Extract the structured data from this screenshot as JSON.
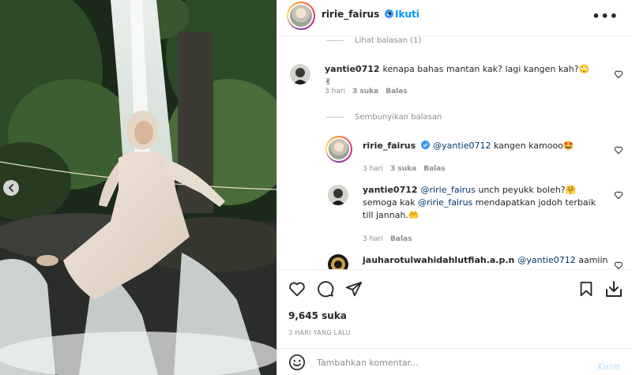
{
  "header": {
    "username": "ririe_fairus",
    "separator": "•",
    "follow_label": "Ikuti",
    "more_label": "•••"
  },
  "comments": {
    "view_replies_label": "Lihat balasan (1)",
    "hide_replies_label": "Sembunyikan balasan",
    "items": [
      {
        "username": "yantie0712",
        "text": "kenapa bahas mantan kak? lagi kangen kah?🙄✌",
        "time": "3 hari",
        "likes": "3 suka",
        "reply_label": "Balas"
      },
      {
        "username": "ririe_fairus",
        "mention": "@yantie0712",
        "text": " kangen kamooo🤩",
        "time": "3 hari",
        "likes": "3 suka",
        "reply_label": "Balas"
      },
      {
        "username": "yantie0712",
        "mention": "@ririe_fairus",
        "text_a": " unch peyukk boleh?🤗",
        "text_b": "semoga kak ",
        "mention_b": "@ririe_fairus",
        "text_c": " mendapatkan jodoh terbaik",
        "text_d": "till jannah.🤲",
        "time": "3 hari",
        "reply_label": "Balas"
      },
      {
        "username": "jauharotulwahidahlutfiah.a.p.n",
        "mention": "@yantie0712",
        "text": " aamiin"
      }
    ]
  },
  "actions": {
    "likes": "9,645 suka",
    "time_ago": "3 HARI YANG LALU",
    "icons": [
      "heart-icon",
      "comment-icon",
      "share-icon",
      "bookmark-icon",
      "download-icon"
    ]
  },
  "composer": {
    "placeholder": "Tambahkan komentar...",
    "post_label": "Kirim"
  },
  "colors": {
    "link": "#0095f6",
    "mention": "#00376b",
    "muted": "#8e8e8e",
    "post_disabled": "#b2dffc"
  }
}
